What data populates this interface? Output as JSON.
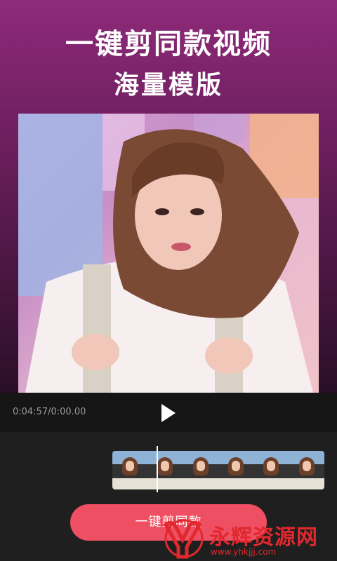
{
  "header": {
    "title_line1": "一键剪同款视频",
    "title_line2": "海量模版"
  },
  "player": {
    "time": "0:04:57/0:00.00",
    "play_icon": "play-icon"
  },
  "timeline": {
    "frame_count": 6
  },
  "cta": {
    "label": "一键剪同款"
  },
  "watermark": {
    "text": "永辉资源网",
    "url": "www.yhkjjj.com"
  },
  "colors": {
    "header_top": "#8e2a7a",
    "cta": "#ef4f62",
    "watermark": "#e0282e"
  }
}
